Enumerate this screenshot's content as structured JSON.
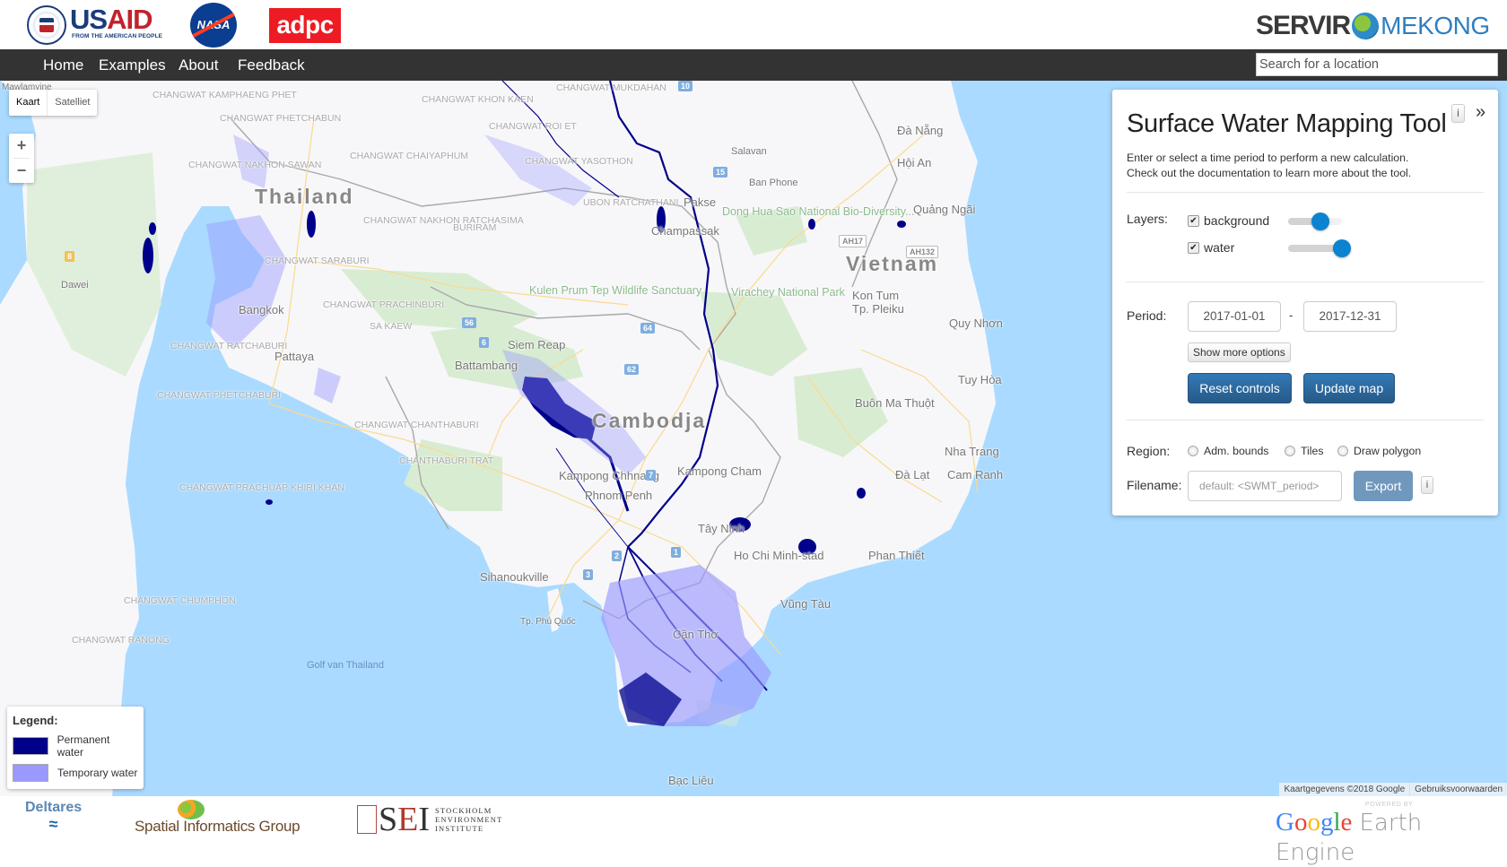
{
  "header": {
    "logos": {
      "usaid": {
        "primary": "US",
        "accent": "AID",
        "tagline": "FROM THE AMERICAN PEOPLE"
      },
      "nasa": "NASA",
      "adpc": "adpc",
      "servir": {
        "left": "SERVIR",
        "right": "MEKONG"
      }
    }
  },
  "navbar": {
    "links": [
      "Home",
      "Examples",
      "About",
      "Feedback"
    ],
    "search_placeholder": "Search for a location"
  },
  "map": {
    "type_controls": [
      "Kaart",
      "Satelliet"
    ],
    "active_type": "Kaart",
    "zoom_in": "+",
    "zoom_out": "−",
    "labels": {
      "countries": [
        "Thailand",
        "Vietnam",
        "Cambodja"
      ],
      "cities": [
        "Bangkok",
        "Pattaya",
        "Siem Reap",
        "Battambang",
        "Phnom Penh",
        "Ho Chi Minh-stad",
        "Pakse",
        "Salavan",
        "Ban Phone",
        "Đà Nẵng",
        "Hội An",
        "Quảng Ngãi",
        "Kon Tum",
        "Tp. Pleiku",
        "Quy Nhơn",
        "Tuy Hòa",
        "Nha Trang",
        "Đà Lạt",
        "Cam Ranh",
        "Phan Thiết",
        "Buôn Ma Thuột",
        "Vũng Tàu",
        "Cần Thơ",
        "Bạc Liêu",
        "Sihanoukville",
        "Tp. Phú Quốc",
        "Kampong Cham",
        "Kampong Chhnang",
        "Tây Ninh",
        "Champassak",
        "Dawei",
        "Mawlamyine"
      ],
      "provinces": [
        "Changwat Kamphaeng Phet",
        "Changwat Phetchabun",
        "Changwat Nakhon Sawan",
        "Changwat Chaiyaphum",
        "Changwat Nakhon Ratchasima",
        "Buriram",
        "Changwat Saraburi",
        "Changwat Prachinburi",
        "Sa Kaew",
        "Changwat Ratchaburi",
        "Changwat Phetchaburi",
        "Changwat Chanthaburi",
        "Chanthaburi Trat",
        "Changwat Prachuap Khiri Khan",
        "Changwat Chumphon",
        "Changwat Ranong",
        "Changwat Mukdahan",
        "Changwat Yasothon",
        "Ubon Ratchathani",
        "Changwat Roi Et",
        "Changwat Khon Kaen"
      ],
      "parks": [
        "Kulen Prum Tep Wildlife Sanctuary",
        "Dong Hua Sao National Bio-Diversity...",
        "Virachey National Park"
      ],
      "seas": [
        "Golf van Thailand"
      ],
      "road_shields": [
        "10",
        "15",
        "56",
        "6",
        "64",
        "62",
        "7",
        "1",
        "2",
        "3",
        "AH17",
        "AH132",
        "8"
      ]
    },
    "attribution": [
      "Kaartgegevens ©2018 Google",
      "Gebruiksvoorwaarden"
    ],
    "colors": {
      "sea": "#aadaff",
      "land": "#f7f7f9",
      "parks": "#d8ecd2",
      "permanent_water": "#00008b",
      "temporary_water": "#9999ff"
    }
  },
  "legend": {
    "title": "Legend:",
    "items": [
      {
        "label": "Permanent water",
        "color": "#000088"
      },
      {
        "label": "Temporary water",
        "color": "#9999ff"
      }
    ]
  },
  "panel": {
    "title": "Surface Water Mapping Tool",
    "info_label": "i",
    "collapse_label": "»",
    "description_line1": "Enter or select a time period to perform a new calculation.",
    "description_line2": "Check out the documentation to learn more about the tool.",
    "layers_label": "Layers:",
    "layers": [
      {
        "name": "background",
        "checked": true,
        "opacity": 0.6
      },
      {
        "name": "water",
        "checked": true,
        "opacity": 1.0
      }
    ],
    "period_label": "Period:",
    "period_start": "2017-01-01",
    "period_separator": "-",
    "period_end": "2017-12-31",
    "more_options_label": "Show more options",
    "reset_label": "Reset controls",
    "update_label": "Update map",
    "region_label": "Region:",
    "region_options": [
      "Adm. bounds",
      "Tiles",
      "Draw polygon"
    ],
    "filename_label": "Filename:",
    "filename_placeholder": "default: <SWMT_period>",
    "export_label": "Export",
    "export_info_label": "i"
  },
  "footer": {
    "deltares": "Deltares",
    "sig": "Spatial Informatics Group",
    "sei": {
      "letters": "SEI",
      "lines": [
        "STOCKHOLM",
        "ENVIRONMENT",
        "INSTITUTE"
      ]
    },
    "gee": {
      "powered_by": "POWERED BY",
      "google": "Google",
      "earth_engine": "Earth Engine"
    }
  }
}
